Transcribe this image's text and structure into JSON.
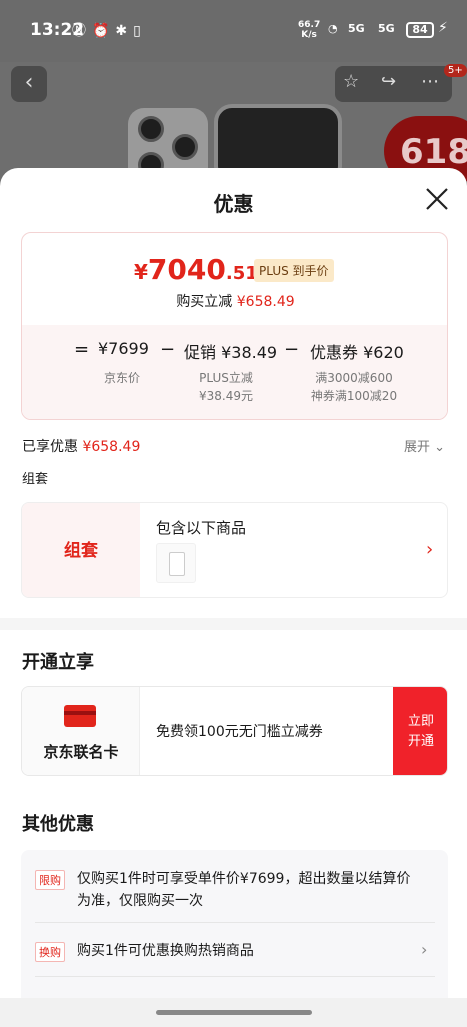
{
  "status_bar": {
    "time": "13:22",
    "net_speed_value": "66.7",
    "net_speed_unit": "K/s",
    "sig1": "5G",
    "sig2": "5G",
    "battery": "84"
  },
  "product": {
    "badge_618": "618",
    "message_count": "5+"
  },
  "sheet": {
    "title": "优惠",
    "price": {
      "yen": "¥",
      "integer": "7040",
      "decimal": ".51",
      "plus_tag": "PLUS 到手价",
      "instant_off_label": "购买立减",
      "instant_off_value": "¥658.49"
    },
    "formula": {
      "eq": "=",
      "jd_price": "¥7699",
      "minus1": "−",
      "promo": "促销 ¥38.49",
      "minus2": "−",
      "coupon": "优惠券 ¥620",
      "jd_price_label": "京东价",
      "promo_sub1": "PLUS立减",
      "promo_sub2": "¥38.49元",
      "coupon_sub1": "满3000减600",
      "coupon_sub2": "神券满100减20"
    },
    "enjoyed_label": "已享优惠",
    "enjoyed_value": "¥658.49",
    "expand_label": "展开",
    "bundle_section_label": "组套",
    "bundle_left": "组套",
    "bundle_title": "包含以下商品",
    "open_section_title": "开通立享",
    "card": {
      "name": "京东联名卡",
      "desc": "免费领100元无门槛立减券",
      "btn_line1": "立即",
      "btn_line2": "开通"
    },
    "other_section_title": "其他优惠",
    "other": [
      {
        "tag": "限购",
        "text": "仅购买1件时可享受单件价¥7699，超出数量以结算价为准，仅限购买一次"
      },
      {
        "tag": "换购",
        "text": "购买1件可优惠换购热销商品"
      }
    ]
  },
  "colors": {
    "accent_red": "#e1251b",
    "plus_gold": "#fbe9c8"
  }
}
